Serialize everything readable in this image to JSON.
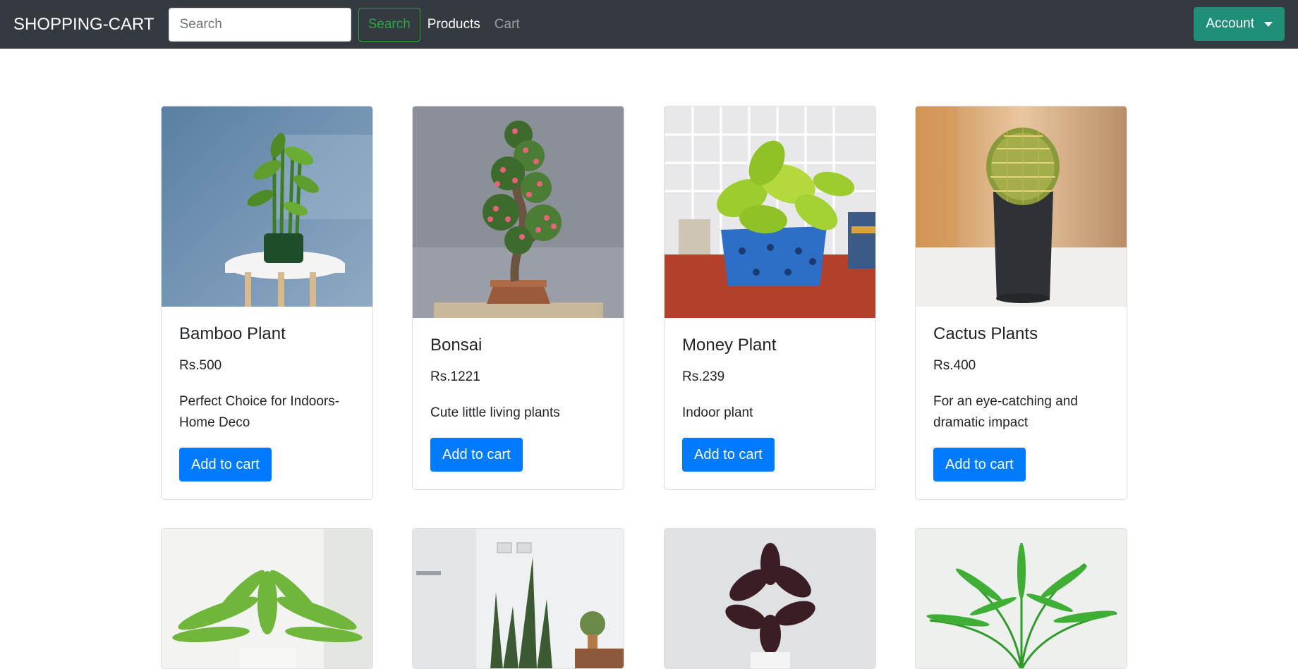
{
  "navbar": {
    "brand": "SHOPPING-CART",
    "search_placeholder": "Search",
    "search_button": "Search",
    "links": [
      "Products",
      "Cart"
    ],
    "account_label": "Account"
  },
  "products": [
    {
      "name": "Bamboo Plant",
      "price": "Rs.500",
      "description": "Perfect Choice for Indoors-Home Deco",
      "button": "Add to cart"
    },
    {
      "name": "Bonsai",
      "price": "Rs.1221",
      "description": "Cute little living plants",
      "button": "Add to cart"
    },
    {
      "name": "Money Plant",
      "price": "Rs.239",
      "description": "Indoor plant",
      "button": "Add to cart"
    },
    {
      "name": "Cactus Plants",
      "price": "Rs.400",
      "description": "For an eye-catching and dramatic impact",
      "button": "Add to cart"
    }
  ],
  "colors": {
    "navbar_bg": "#343a40",
    "search_accent": "#28a745",
    "account_bg": "#1f8f7a",
    "primary": "#007bff"
  }
}
